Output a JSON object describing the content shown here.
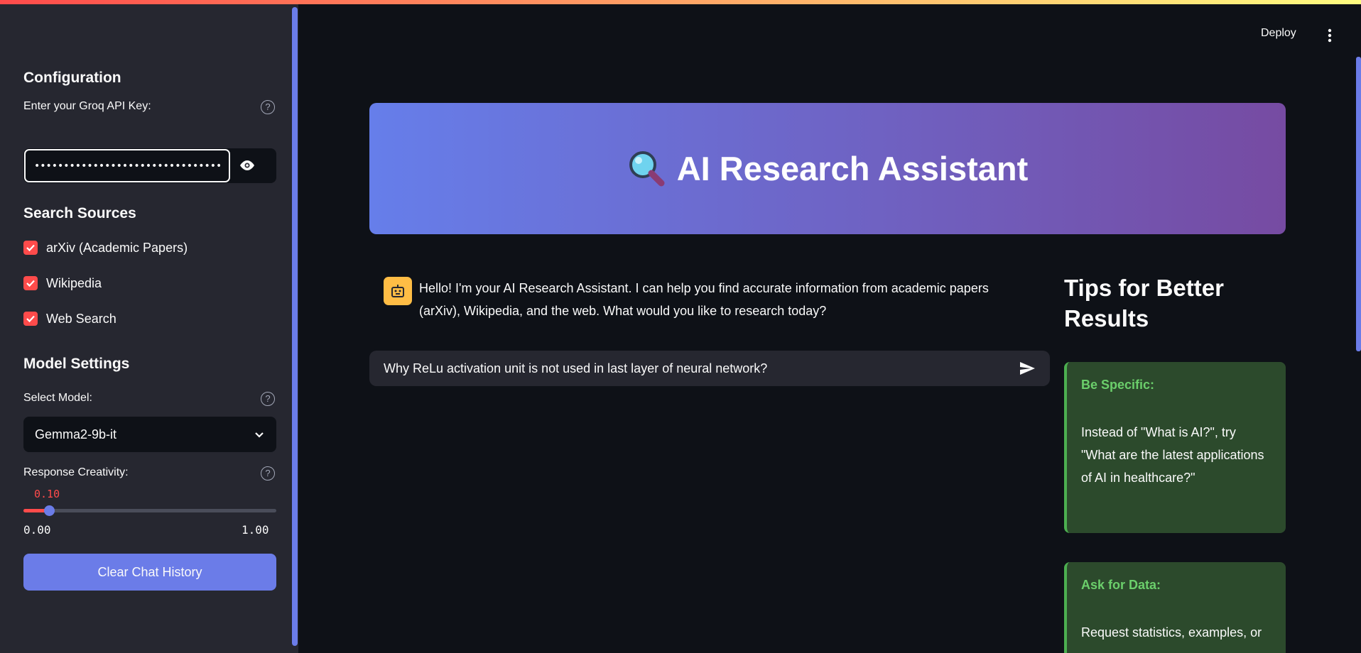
{
  "header": {
    "deploy_label": "Deploy",
    "menu_icon": "vertical-dots-icon"
  },
  "sidebar": {
    "config_heading": "Configuration",
    "api_key_label": "Enter your Groq API Key:",
    "api_key_value": "••••••••••••••••••••••••••••••••••••••••••••••••••••",
    "sources_heading": "Search Sources",
    "sources": [
      {
        "label": "arXiv (Academic Papers)",
        "checked": true
      },
      {
        "label": "Wikipedia",
        "checked": true
      },
      {
        "label": "Web Search",
        "checked": true
      }
    ],
    "model_heading": "Model Settings",
    "select_model_label": "Select Model:",
    "selected_model": "Gemma2-9b-it",
    "creativity_label": "Response Creativity:",
    "creativity_value": "0.10",
    "creativity_fraction": 0.1,
    "creativity_min": "0.00",
    "creativity_max": "1.00",
    "clear_button_label": "Clear Chat History"
  },
  "banner": {
    "icon": "magnifying-glass-icon",
    "title": "AI Research Assistant"
  },
  "chat": {
    "assistant_message": "Hello! I'm your AI Research Assistant. I can help you find accurate information from academic papers (arXiv), Wikipedia, and the web. What would you like to research today?",
    "input_value": "Why ReLu activation unit is not used in last layer of neural network?"
  },
  "tips": {
    "title": "Tips for Better Results",
    "cards": [
      {
        "heading": "Be Specific:",
        "body": "Instead of \"What is AI?\", try \"What are the latest applications of AI in healthcare?\""
      },
      {
        "heading": "Ask for Data:",
        "body": "Request statistics, examples, or"
      }
    ]
  },
  "colors": {
    "accent": "#ff4b4b",
    "primary": "#6b7ce8",
    "banner_start": "#667eea",
    "banner_end": "#764ba2",
    "tip_bg": "#2c4a2c",
    "tip_border": "#4caf50"
  }
}
